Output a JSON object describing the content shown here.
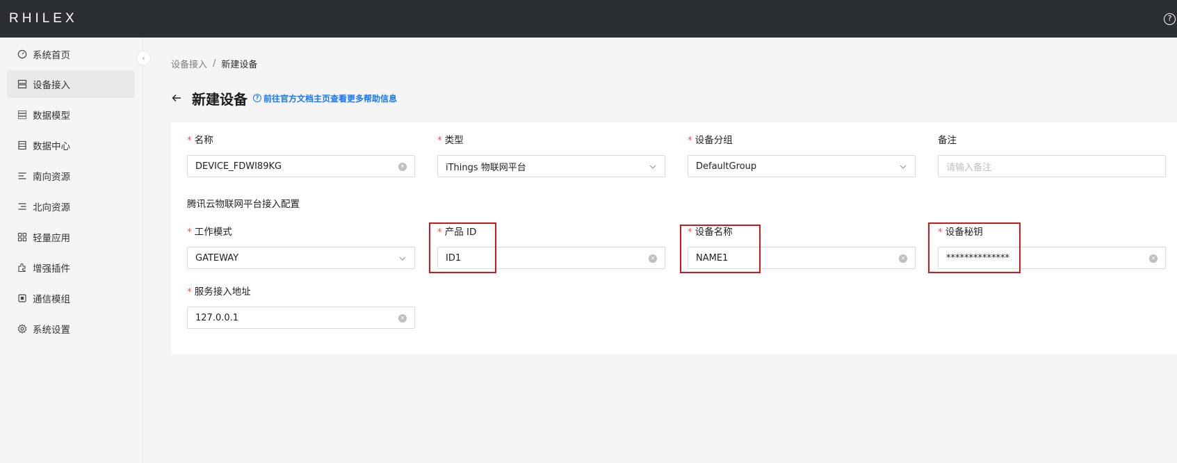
{
  "app": {
    "logo": "RHILEX",
    "help_symbol": "?"
  },
  "sidebar": {
    "collapse_symbol": "‹",
    "items": [
      {
        "label": "系统首页",
        "icon": "dashboard-icon",
        "active": false
      },
      {
        "label": "设备接入",
        "icon": "device-icon",
        "active": true
      },
      {
        "label": "数据模型",
        "icon": "database-icon",
        "active": false
      },
      {
        "label": "数据中心",
        "icon": "table-icon",
        "active": false
      },
      {
        "label": "南向资源",
        "icon": "align-left-icon",
        "active": false
      },
      {
        "label": "北向资源",
        "icon": "align-right-icon",
        "active": false
      },
      {
        "label": "轻量应用",
        "icon": "apps-icon",
        "active": false
      },
      {
        "label": "增强插件",
        "icon": "plugin-icon",
        "active": false
      },
      {
        "label": "通信模组",
        "icon": "chip-icon",
        "active": false
      },
      {
        "label": "系统设置",
        "icon": "gear-icon",
        "active": false
      }
    ]
  },
  "breadcrumb": {
    "parent": "设备接入",
    "separator": "/",
    "current": "新建设备"
  },
  "page": {
    "title": "新建设备",
    "help_link": "前往官方文档主页查看更多帮助信息"
  },
  "form": {
    "required_mark": "*",
    "name": {
      "label": "名称",
      "value": "DEVICE_FDWI89KG"
    },
    "type": {
      "label": "类型",
      "value": "iThings 物联网平台"
    },
    "group": {
      "label": "设备分组",
      "value": "DefaultGroup"
    },
    "remark": {
      "label": "备注",
      "placeholder": "请输入备注"
    },
    "section_title": "腾讯云物联网平台接入配置",
    "mode": {
      "label": "工作模式",
      "value": "GATEWAY"
    },
    "product_id": {
      "label": "产品 ID",
      "value": "ID1"
    },
    "device_name": {
      "label": "设备名称",
      "value": "NAME1"
    },
    "device_secret": {
      "label": "设备秘钥",
      "value": "**************"
    },
    "server": {
      "label": "服务接入地址",
      "value": "127.0.0.1"
    }
  },
  "colors": {
    "header": "#2b2f33",
    "accent": "#1677ff",
    "required": "#ff4d4f",
    "highlight": "#d0181c"
  }
}
